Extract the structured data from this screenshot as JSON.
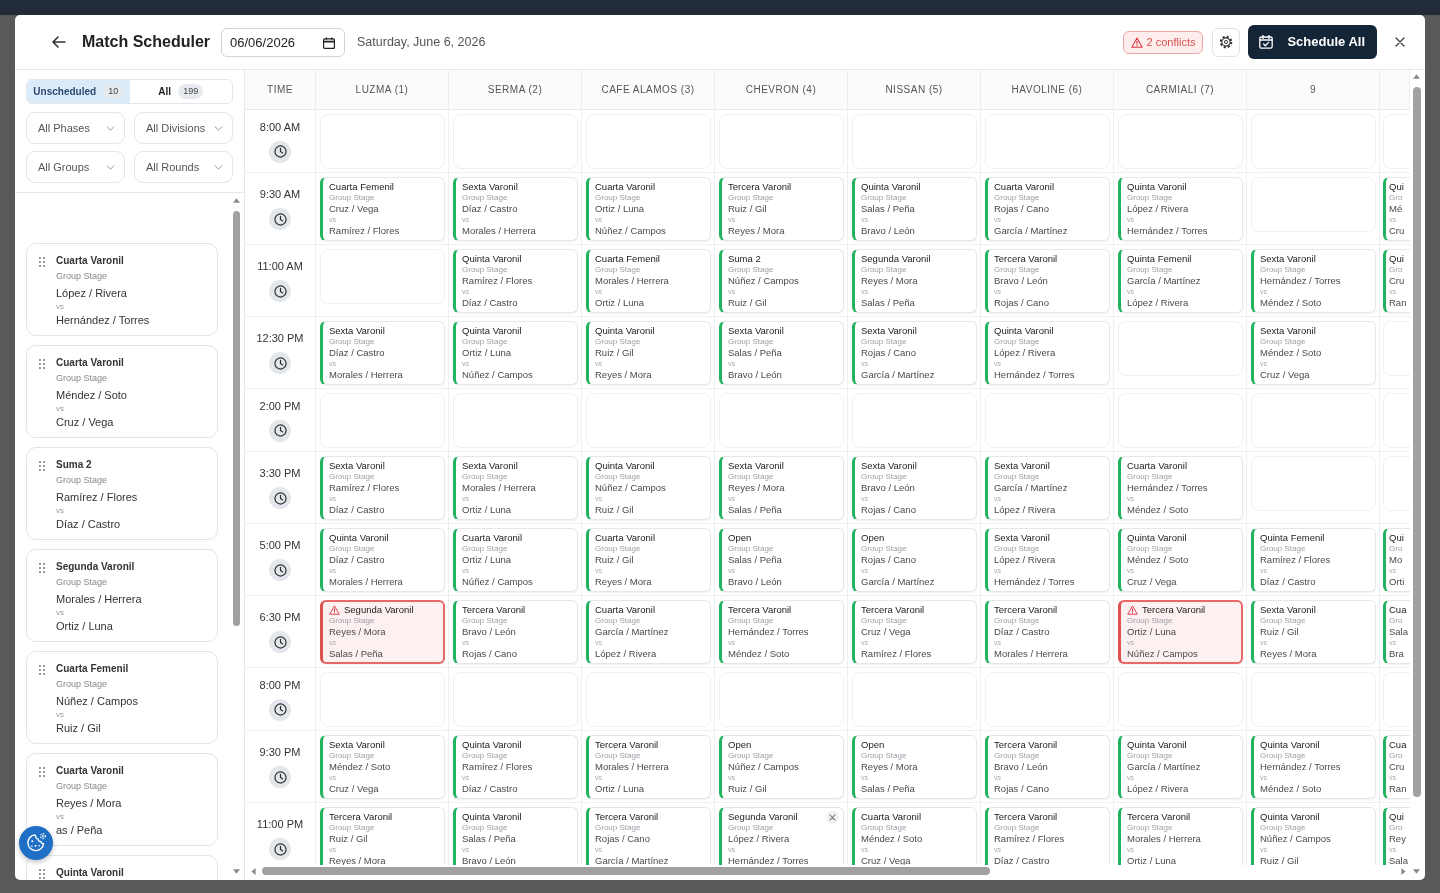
{
  "header": {
    "title": "Match Scheduler",
    "date": "06/06/2026",
    "date_label": "Saturday, June 6, 2026",
    "conflicts": "2 conflicts",
    "schedule_button": "Schedule All"
  },
  "sidebar": {
    "tabs": [
      {
        "label": "Unscheduled",
        "count": "10",
        "selected": true
      },
      {
        "label": "All",
        "count": "199",
        "selected": false
      }
    ],
    "filters": [
      "All Phases",
      "All Divisions",
      "All Groups",
      "All Rounds"
    ],
    "matches": [
      {
        "division": "Cuarta Varonil",
        "stage": "Group Stage",
        "team1": "López / Rivera",
        "vs": "vs",
        "team2": "Hernández / Torres"
      },
      {
        "division": "Cuarta Varonil",
        "stage": "Group Stage",
        "team1": "Méndez / Soto",
        "vs": "vs",
        "team2": "Cruz / Vega"
      },
      {
        "division": "Suma 2",
        "stage": "Group Stage",
        "team1": "Ramírez / Flores",
        "vs": "vs",
        "team2": "Díaz / Castro"
      },
      {
        "division": "Segunda Varonil",
        "stage": "Group Stage",
        "team1": "Morales / Herrera",
        "vs": "vs",
        "team2": "Ortiz / Luna"
      },
      {
        "division": "Cuarta Femenil",
        "stage": "Group Stage",
        "team1": "Núñez / Campos",
        "vs": "vs",
        "team2": "Ruiz / Gil"
      },
      {
        "division": "Cuarta Varonil",
        "stage": "Group Stage",
        "team1": "Reyes / Mora",
        "vs": "vs",
        "team2": "as / Peña"
      },
      {
        "division": "Quinta Varonil"
      }
    ]
  },
  "schedule": {
    "time_heading": "TIME",
    "courts": [
      "LUZMA (1)",
      "SERMA (2)",
      "CAFE ALAMOS (3)",
      "CHEVRON (4)",
      "NISSAN (5)",
      "HAVOLINE (6)",
      "CARMIALI (7)",
      "9"
    ],
    "rows": [
      {
        "time": "8:00 AM",
        "slots": [
          {
            "kind": "empty"
          },
          {
            "kind": "empty"
          },
          {
            "kind": "empty"
          },
          {
            "kind": "empty"
          },
          {
            "kind": "empty"
          },
          {
            "kind": "empty"
          },
          {
            "kind": "empty"
          },
          {
            "kind": "empty"
          },
          {
            "kind": "empty"
          }
        ]
      },
      {
        "time": "9:30 AM",
        "slots": [
          {
            "kind": "match",
            "division": "Cuarta Femenil",
            "stage": "Group Stage",
            "team1": "Cruz / Vega",
            "vs": "vs",
            "team2": "Ramírez / Flores",
            "conflict": false,
            "hovered": false
          },
          {
            "kind": "match",
            "division": "Sexta Varonil",
            "stage": "Group Stage",
            "team1": "Díaz / Castro",
            "vs": "vs",
            "team2": "Morales / Herrera",
            "conflict": false,
            "hovered": false
          },
          {
            "kind": "match",
            "division": "Cuarta Varonil",
            "stage": "Group Stage",
            "team1": "Ortiz / Luna",
            "vs": "vs",
            "team2": "Núñez / Campos",
            "conflict": false,
            "hovered": false
          },
          {
            "kind": "match",
            "division": "Tercera Varonil",
            "stage": "Group Stage",
            "team1": "Ruiz / Gil",
            "vs": "vs",
            "team2": "Reyes / Mora",
            "conflict": false,
            "hovered": false
          },
          {
            "kind": "match",
            "division": "Quinta Varonil",
            "stage": "Group Stage",
            "team1": "Salas / Peña",
            "vs": "vs",
            "team2": "Bravo / León",
            "conflict": false,
            "hovered": false
          },
          {
            "kind": "match",
            "division": "Cuarta Varonil",
            "stage": "Group Stage",
            "team1": "Rojas / Cano",
            "vs": "vs",
            "team2": "García / Martínez",
            "conflict": false,
            "hovered": false
          },
          {
            "kind": "match",
            "division": "Quinta Varonil",
            "stage": "Group Stage",
            "team1": "López / Rivera",
            "vs": "vs",
            "team2": "Hernández / Torres",
            "conflict": false,
            "hovered": false
          },
          {
            "kind": "empty"
          },
          {
            "kind": "match",
            "division": "Qui",
            "stage": "Gro",
            "team1": "Mé",
            "vs": "vs",
            "team2": "Cru",
            "conflict": false,
            "hovered": false
          }
        ]
      },
      {
        "time": "11:00 AM",
        "slots": [
          {
            "kind": "empty"
          },
          {
            "kind": "match",
            "division": "Quinta Varonil",
            "stage": "Group Stage",
            "team1": "Ramírez / Flores",
            "vs": "vs",
            "team2": "Díaz / Castro",
            "conflict": false,
            "hovered": false
          },
          {
            "kind": "match",
            "division": "Cuarta Femenil",
            "stage": "Group Stage",
            "team1": "Morales / Herrera",
            "vs": "vs",
            "team2": "Ortiz / Luna",
            "conflict": false,
            "hovered": false
          },
          {
            "kind": "match",
            "division": "Suma 2",
            "stage": "Group Stage",
            "team1": "Núñez / Campos",
            "vs": "vs",
            "team2": "Ruiz / Gil",
            "conflict": false,
            "hovered": false
          },
          {
            "kind": "match",
            "division": "Segunda Varonil",
            "stage": "Group Stage",
            "team1": "Reyes / Mora",
            "vs": "vs",
            "team2": "Salas / Peña",
            "conflict": false,
            "hovered": false
          },
          {
            "kind": "match",
            "division": "Tercera Varonil",
            "stage": "Group Stage",
            "team1": "Bravo / León",
            "vs": "vs",
            "team2": "Rojas / Cano",
            "conflict": false,
            "hovered": false
          },
          {
            "kind": "match",
            "division": "Quinta Femenil",
            "stage": "Group Stage",
            "team1": "García / Martínez",
            "vs": "vs",
            "team2": "López / Rivera",
            "conflict": false,
            "hovered": false
          },
          {
            "kind": "match",
            "division": "Sexta Varonil",
            "stage": "Group Stage",
            "team1": "Hernández / Torres",
            "vs": "vs",
            "team2": "Méndez / Soto",
            "conflict": false,
            "hovered": false
          },
          {
            "kind": "match",
            "division": "Qui",
            "stage": "Gro",
            "team1": "Cru",
            "vs": "vs",
            "team2": "Ran",
            "conflict": false,
            "hovered": false
          }
        ]
      },
      {
        "time": "12:30 PM",
        "slots": [
          {
            "kind": "match",
            "division": "Sexta Varonil",
            "stage": "Group Stage",
            "team1": "Díaz / Castro",
            "vs": "vs",
            "team2": "Morales / Herrera",
            "conflict": false,
            "hovered": false
          },
          {
            "kind": "match",
            "division": "Quinta Varonil",
            "stage": "Group Stage",
            "team1": "Ortiz / Luna",
            "vs": "vs",
            "team2": "Núñez / Campos",
            "conflict": false,
            "hovered": false
          },
          {
            "kind": "match",
            "division": "Quinta Varonil",
            "stage": "Group Stage",
            "team1": "Ruiz / Gil",
            "vs": "vs",
            "team2": "Reyes / Mora",
            "conflict": false,
            "hovered": false
          },
          {
            "kind": "match",
            "division": "Sexta Varonil",
            "stage": "Group Stage",
            "team1": "Salas / Peña",
            "vs": "vs",
            "team2": "Bravo / León",
            "conflict": false,
            "hovered": false
          },
          {
            "kind": "match",
            "division": "Sexta Varonil",
            "stage": "Group Stage",
            "team1": "Rojas / Cano",
            "vs": "vs",
            "team2": "García / Martínez",
            "conflict": false,
            "hovered": false
          },
          {
            "kind": "match",
            "division": "Quinta Varonil",
            "stage": "Group Stage",
            "team1": "López / Rivera",
            "vs": "vs",
            "team2": "Hernández / Torres",
            "conflict": false,
            "hovered": false
          },
          {
            "kind": "empty"
          },
          {
            "kind": "match",
            "division": "Sexta Varonil",
            "stage": "Group Stage",
            "team1": "Méndez / Soto",
            "vs": "vs",
            "team2": "Cruz / Vega",
            "conflict": false,
            "hovered": false
          },
          {
            "kind": "empty"
          }
        ]
      },
      {
        "time": "2:00 PM",
        "slots": [
          {
            "kind": "empty"
          },
          {
            "kind": "empty"
          },
          {
            "kind": "empty"
          },
          {
            "kind": "empty"
          },
          {
            "kind": "empty"
          },
          {
            "kind": "empty"
          },
          {
            "kind": "empty"
          },
          {
            "kind": "empty"
          },
          {
            "kind": "empty"
          }
        ]
      },
      {
        "time": "3:30 PM",
        "slots": [
          {
            "kind": "match",
            "division": "Sexta Varonil",
            "stage": "Group Stage",
            "team1": "Ramírez / Flores",
            "vs": "vs",
            "team2": "Díaz / Castro",
            "conflict": false,
            "hovered": false
          },
          {
            "kind": "match",
            "division": "Sexta Varonil",
            "stage": "Group Stage",
            "team1": "Morales / Herrera",
            "vs": "vs",
            "team2": "Ortiz / Luna",
            "conflict": false,
            "hovered": false
          },
          {
            "kind": "match",
            "division": "Quinta Varonil",
            "stage": "Group Stage",
            "team1": "Núñez / Campos",
            "vs": "vs",
            "team2": "Ruiz / Gil",
            "conflict": false,
            "hovered": false
          },
          {
            "kind": "match",
            "division": "Sexta Varonil",
            "stage": "Group Stage",
            "team1": "Reyes / Mora",
            "vs": "vs",
            "team2": "Salas / Peña",
            "conflict": false,
            "hovered": false
          },
          {
            "kind": "match",
            "division": "Sexta Varonil",
            "stage": "Group Stage",
            "team1": "Bravo / León",
            "vs": "vs",
            "team2": "Rojas / Cano",
            "conflict": false,
            "hovered": false
          },
          {
            "kind": "match",
            "division": "Sexta Varonil",
            "stage": "Group Stage",
            "team1": "García / Martínez",
            "vs": "vs",
            "team2": "López / Rivera",
            "conflict": false,
            "hovered": false
          },
          {
            "kind": "match",
            "division": "Cuarta Varonil",
            "stage": "Group Stage",
            "team1": "Hernández / Torres",
            "vs": "vs",
            "team2": "Méndez / Soto",
            "conflict": false,
            "hovered": false
          },
          {
            "kind": "empty"
          },
          {
            "kind": "empty"
          }
        ]
      },
      {
        "time": "5:00 PM",
        "slots": [
          {
            "kind": "match",
            "division": "Quinta Varonil",
            "stage": "Group Stage",
            "team1": "Díaz / Castro",
            "vs": "vs",
            "team2": "Morales / Herrera",
            "conflict": false,
            "hovered": false
          },
          {
            "kind": "match",
            "division": "Cuarta Varonil",
            "stage": "Group Stage",
            "team1": "Ortiz / Luna",
            "vs": "vs",
            "team2": "Núñez / Campos",
            "conflict": false,
            "hovered": false
          },
          {
            "kind": "match",
            "division": "Cuarta Varonil",
            "stage": "Group Stage",
            "team1": "Ruiz / Gil",
            "vs": "vs",
            "team2": "Reyes / Mora",
            "conflict": false,
            "hovered": false
          },
          {
            "kind": "match",
            "division": "Open",
            "stage": "Group Stage",
            "team1": "Salas / Peña",
            "vs": "vs",
            "team2": "Bravo / León",
            "conflict": false,
            "hovered": false
          },
          {
            "kind": "match",
            "division": "Open",
            "stage": "Group Stage",
            "team1": "Rojas / Cano",
            "vs": "vs",
            "team2": "García / Martínez",
            "conflict": false,
            "hovered": false
          },
          {
            "kind": "match",
            "division": "Sexta Varonil",
            "stage": "Group Stage",
            "team1": "López / Rivera",
            "vs": "vs",
            "team2": "Hernández / Torres",
            "conflict": false,
            "hovered": false
          },
          {
            "kind": "match",
            "division": "Quinta Varonil",
            "stage": "Group Stage",
            "team1": "Méndez / Soto",
            "vs": "vs",
            "team2": "Cruz / Vega",
            "conflict": false,
            "hovered": false
          },
          {
            "kind": "match",
            "division": "Quinta Femenil",
            "stage": "Group Stage",
            "team1": "Ramírez / Flores",
            "vs": "vs",
            "team2": "Díaz / Castro",
            "conflict": false,
            "hovered": false
          },
          {
            "kind": "match",
            "division": "Qui",
            "stage": "Gro",
            "team1": "Mo",
            "vs": "vs",
            "team2": "Orti",
            "conflict": false,
            "hovered": false
          }
        ]
      },
      {
        "time": "6:30 PM",
        "slots": [
          {
            "kind": "match",
            "division": "Segunda Varonil",
            "stage": "Group Stage",
            "team1": "Reyes / Mora",
            "vs": "vs",
            "team2": "Salas / Peña",
            "conflict": true,
            "hovered": false
          },
          {
            "kind": "match",
            "division": "Tercera Varonil",
            "stage": "Group Stage",
            "team1": "Bravo / León",
            "vs": "vs",
            "team2": "Rojas / Cano",
            "conflict": false,
            "hovered": false
          },
          {
            "kind": "match",
            "division": "Cuarta Varonil",
            "stage": "Group Stage",
            "team1": "García / Martínez",
            "vs": "vs",
            "team2": "López / Rivera",
            "conflict": false,
            "hovered": false
          },
          {
            "kind": "match",
            "division": "Tercera Varonil",
            "stage": "Group Stage",
            "team1": "Hernández / Torres",
            "vs": "vs",
            "team2": "Méndez / Soto",
            "conflict": false,
            "hovered": false
          },
          {
            "kind": "match",
            "division": "Tercera Varonil",
            "stage": "Group Stage",
            "team1": "Cruz / Vega",
            "vs": "vs",
            "team2": "Ramírez / Flores",
            "conflict": false,
            "hovered": false
          },
          {
            "kind": "match",
            "division": "Tercera Varonil",
            "stage": "Group Stage",
            "team1": "Díaz / Castro",
            "vs": "vs",
            "team2": "Morales / Herrera",
            "conflict": false,
            "hovered": false
          },
          {
            "kind": "match",
            "division": "Tercera Varonil",
            "stage": "Group Stage",
            "team1": "Ortiz / Luna",
            "vs": "vs",
            "team2": "Núñez / Campos",
            "conflict": true,
            "hovered": false
          },
          {
            "kind": "match",
            "division": "Sexta Varonil",
            "stage": "Group Stage",
            "team1": "Ruiz / Gil",
            "vs": "vs",
            "team2": "Reyes / Mora",
            "conflict": false,
            "hovered": false
          },
          {
            "kind": "match",
            "division": "Cua",
            "stage": "Gro",
            "team1": "Sala",
            "vs": "vs",
            "team2": "Bra",
            "conflict": false,
            "hovered": false
          }
        ]
      },
      {
        "time": "8:00 PM",
        "slots": [
          {
            "kind": "empty"
          },
          {
            "kind": "empty"
          },
          {
            "kind": "empty"
          },
          {
            "kind": "empty"
          },
          {
            "kind": "empty"
          },
          {
            "kind": "empty"
          },
          {
            "kind": "empty"
          },
          {
            "kind": "empty"
          },
          {
            "kind": "empty"
          }
        ]
      },
      {
        "time": "9:30 PM",
        "slots": [
          {
            "kind": "match",
            "division": "Sexta Varonil",
            "stage": "Group Stage",
            "team1": "Méndez / Soto",
            "vs": "vs",
            "team2": "Cruz / Vega",
            "conflict": false,
            "hovered": false
          },
          {
            "kind": "match",
            "division": "Quinta Varonil",
            "stage": "Group Stage",
            "team1": "Ramírez / Flores",
            "vs": "vs",
            "team2": "Díaz / Castro",
            "conflict": false,
            "hovered": false
          },
          {
            "kind": "match",
            "division": "Tercera Varonil",
            "stage": "Group Stage",
            "team1": "Morales / Herrera",
            "vs": "vs",
            "team2": "Ortiz / Luna",
            "conflict": false,
            "hovered": false
          },
          {
            "kind": "match",
            "division": "Open",
            "stage": "Group Stage",
            "team1": "Núñez / Campos",
            "vs": "vs",
            "team2": "Ruiz / Gil",
            "conflict": false,
            "hovered": false
          },
          {
            "kind": "match",
            "division": "Open",
            "stage": "Group Stage",
            "team1": "Reyes / Mora",
            "vs": "vs",
            "team2": "Salas / Peña",
            "conflict": false,
            "hovered": false
          },
          {
            "kind": "match",
            "division": "Tercera Varonil",
            "stage": "Group Stage",
            "team1": "Bravo / León",
            "vs": "vs",
            "team2": "Rojas / Cano",
            "conflict": false,
            "hovered": false
          },
          {
            "kind": "match",
            "division": "Quinta Varonil",
            "stage": "Group Stage",
            "team1": "García / Martínez",
            "vs": "vs",
            "team2": "López / Rivera",
            "conflict": false,
            "hovered": false
          },
          {
            "kind": "match",
            "division": "Quinta Varonil",
            "stage": "Group Stage",
            "team1": "Hernández / Torres",
            "vs": "vs",
            "team2": "Méndez / Soto",
            "conflict": false,
            "hovered": false
          },
          {
            "kind": "match",
            "division": "Cua",
            "stage": "Gro",
            "team1": "Cru",
            "vs": "vs",
            "team2": "Ran",
            "conflict": false,
            "hovered": false
          }
        ]
      },
      {
        "time": "11:00 PM",
        "slots": [
          {
            "kind": "match",
            "division": "Tercera Varonil",
            "stage": "Group Stage",
            "team1": "Ruiz / Gil",
            "vs": "vs",
            "team2": "Reyes / Mora",
            "conflict": false,
            "hovered": false
          },
          {
            "kind": "match",
            "division": "Quinta Varonil",
            "stage": "Group Stage",
            "team1": "Salas / Peña",
            "vs": "vs",
            "team2": "Bravo / León",
            "conflict": false,
            "hovered": false
          },
          {
            "kind": "match",
            "division": "Tercera Varonil",
            "stage": "Group Stage",
            "team1": "Rojas / Cano",
            "vs": "vs",
            "team2": "García / Martínez",
            "conflict": false,
            "hovered": false
          },
          {
            "kind": "match",
            "division": "Segunda Varonil",
            "stage": "Group Stage",
            "team1": "López / Rivera",
            "vs": "vs",
            "team2": "Hernández / Torres",
            "conflict": false,
            "hovered": true
          },
          {
            "kind": "match",
            "division": "Cuarta Varonil",
            "stage": "Group Stage",
            "team1": "Méndez / Soto",
            "vs": "vs",
            "team2": "Cruz / Vega",
            "conflict": false,
            "hovered": false
          },
          {
            "kind": "match",
            "division": "Tercera Varonil",
            "stage": "Group Stage",
            "team1": "Ramírez / Flores",
            "vs": "vs",
            "team2": "Díaz / Castro",
            "conflict": false,
            "hovered": false
          },
          {
            "kind": "match",
            "division": "Tercera Varonil",
            "stage": "Group Stage",
            "team1": "Morales / Herrera",
            "vs": "vs",
            "team2": "Ortiz / Luna",
            "conflict": false,
            "hovered": false
          },
          {
            "kind": "match",
            "division": "Quinta Varonil",
            "stage": "Group Stage",
            "team1": "Núñez / Campos",
            "vs": "vs",
            "team2": "Ruiz / Gil",
            "conflict": false,
            "hovered": false
          },
          {
            "kind": "match",
            "division": "Qui",
            "stage": "Gro",
            "team1": "Rey",
            "vs": "vs",
            "team2": "Sala",
            "conflict": false,
            "hovered": false
          }
        ]
      }
    ]
  }
}
